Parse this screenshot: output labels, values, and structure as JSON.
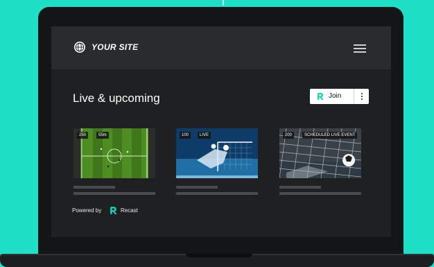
{
  "site": {
    "title": "YOUR SITE"
  },
  "section": {
    "title": "Live & upcoming"
  },
  "join_button": {
    "label": "Join"
  },
  "cards": [
    {
      "badges": [
        "250",
        "55m"
      ]
    },
    {
      "badges": [
        "100",
        "LIVE"
      ]
    },
    {
      "badges": [
        "200",
        "SCHEDULED LIVE EVENT"
      ]
    }
  ],
  "footer": {
    "powered_by": "Powered by",
    "brand": "Recast"
  },
  "colors": {
    "background": "#1ee0c7",
    "accent": "#19d3b9",
    "screen": "#1f2021",
    "navbar": "#2a2b2d"
  },
  "icons": {
    "site_logo": "globe-icon",
    "menu": "hamburger-menu-icon",
    "more": "more-vertical-icon",
    "brand": "recast-logo-icon"
  }
}
